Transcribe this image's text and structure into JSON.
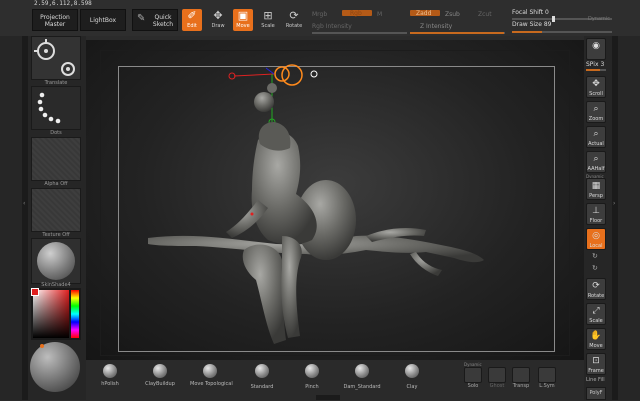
{
  "coords": "2.59,6.112,8.598",
  "header": {
    "projection_master": "Projection Master",
    "lightbox": "LightBox",
    "quick_sketch": "Quick Sketch"
  },
  "tools": [
    {
      "label": "Edit",
      "icon": "edit-icon",
      "active": true
    },
    {
      "label": "Draw",
      "icon": "draw-icon",
      "active": false
    },
    {
      "label": "Move",
      "icon": "move-icon",
      "active": true
    },
    {
      "label": "Scale",
      "icon": "scale-icon",
      "active": false
    },
    {
      "label": "Rotate",
      "icon": "rotate-icon",
      "active": false
    }
  ],
  "mrgb": {
    "mrgb": "Mrgb",
    "rgb": "Rgb",
    "m": "M",
    "rgb_intensity": "Rgb Intensity"
  },
  "zadd": {
    "zadd": "Zadd",
    "zsub": "Zsub",
    "zcut": "Zcut",
    "z_intensity": "Z Intensity"
  },
  "focal_shift": {
    "label": "Focal Shift",
    "value": "0"
  },
  "draw_size": {
    "label": "Draw Size",
    "value": "89"
  },
  "dynamic": "Dynamic",
  "left_panel": {
    "brush_label": "Translate",
    "stroke_label": "Dots",
    "alpha_label": "Alpha Off",
    "texture_label": "Texture Off",
    "material_label": "SkinShade4"
  },
  "right_panel": {
    "spix_label": "SPix",
    "spix_value": "3",
    "bpr": "BPR",
    "buttons": [
      "Scroll",
      "Zoom",
      "Actual",
      "AAHalf",
      "Persp",
      "Floor",
      "Local",
      "Rotate",
      "Scale",
      "Move",
      "Frame"
    ],
    "dynamic": "Dynamic",
    "xyz": "Xyz",
    "line_fill": "Line Fill",
    "polyf": "PolyF"
  },
  "shelf": {
    "brushes": [
      "hPolish",
      "ClayBuildup",
      "Move Topological",
      "Standard",
      "Pinch",
      "Dam_Standard",
      "Clay"
    ],
    "dynamic": "Dynamic",
    "solo": "Solo",
    "ghost": "Ghost",
    "transp": "Transp",
    "lsym": "L.Sym"
  }
}
